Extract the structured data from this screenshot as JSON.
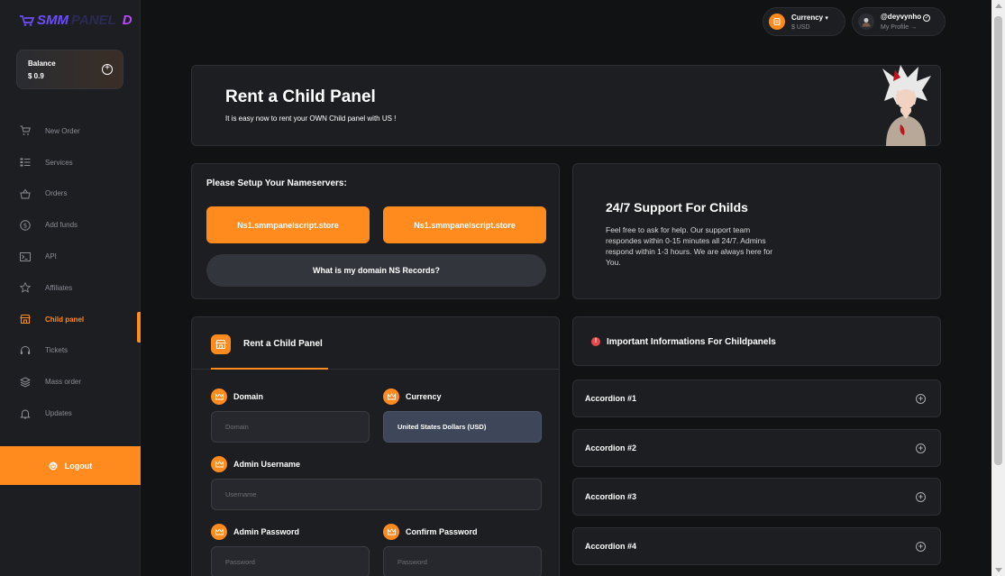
{
  "logo": {
    "part1": "SMM",
    "part2": "PANEL",
    "part3": "D"
  },
  "balance": {
    "label": "Balance",
    "value": "$ 0.9"
  },
  "nav": [
    {
      "label": "New Order",
      "icon": "cart-icon"
    },
    {
      "label": "Services",
      "icon": "list-icon"
    },
    {
      "label": "Orders",
      "icon": "basket-icon"
    },
    {
      "label": "Add funds",
      "icon": "dollar-icon"
    },
    {
      "label": "API",
      "icon": "terminal-icon"
    },
    {
      "label": "Affiliates",
      "icon": "star-icon"
    },
    {
      "label": "Child panel",
      "icon": "store-icon",
      "active": true
    },
    {
      "label": "Tickets",
      "icon": "headset-icon"
    },
    {
      "label": "Mass order",
      "icon": "layers-icon"
    },
    {
      "label": "Updates",
      "icon": "bell-icon"
    }
  ],
  "logout": "Logout",
  "topbar": {
    "currency": {
      "title": "Currency",
      "value": "$ USD"
    },
    "profile": {
      "username": "@deyvynho",
      "link": "My Profile"
    }
  },
  "hero": {
    "title": "Rent a Child Panel",
    "subtitle": "It is easy now to rent your OWN Child panel with US !"
  },
  "nameservers": {
    "title": "Please Setup Your Nameservers:",
    "ns1": "Ns1.smmpanelscript.store",
    "ns2": "Ns1.smmpanelscript.store",
    "help": "What is my domain NS Records?"
  },
  "support": {
    "title": "24/7 Support For Childs",
    "text": "Feel free to ask for help. Our support team respondes within 0-15 minutes all 24/7. Admins respond within 1-3 hours. We are always here for You."
  },
  "form": {
    "tab_label": "Rent a Child Panel",
    "domain": {
      "label": "Domain",
      "placeholder": "Domain"
    },
    "currency": {
      "label": "Currency",
      "value": "United States Dollars (USD)"
    },
    "admin_username": {
      "label": "Admin Username",
      "placeholder": "Username"
    },
    "admin_password": {
      "label": "Admin Password",
      "placeholder": "Password"
    },
    "confirm_password": {
      "label": "Confirm Password",
      "placeholder": "Password"
    }
  },
  "info": {
    "title": "Important Informations For Childpanels",
    "icon_text": "!"
  },
  "accordions": [
    "Accordion #1",
    "Accordion #2",
    "Accordion #3",
    "Accordion #4"
  ],
  "colors": {
    "accent": "#ff8a1e",
    "background": "#111214",
    "card": "#1c1e22",
    "select": "#3e4659",
    "alert": "#e84a4a"
  }
}
